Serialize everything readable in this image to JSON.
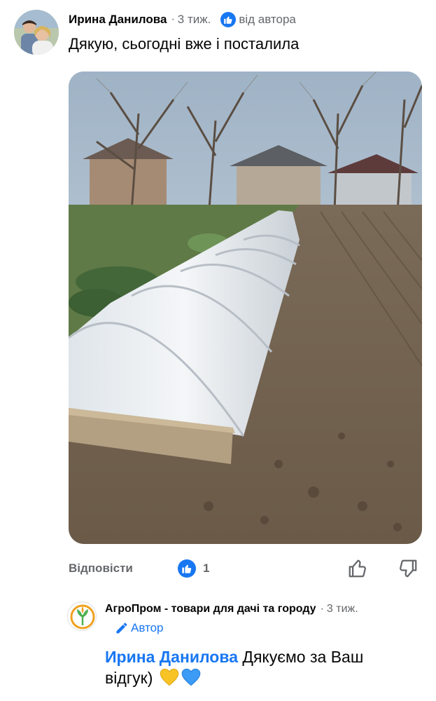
{
  "comment": {
    "author": "Ирина Данилова",
    "time": "3 тиж.",
    "from_author_label": "від автора",
    "text": "Дякую, сьогодні вже і посталила",
    "reply_label": "Відповісти",
    "reaction_count": "1"
  },
  "reply": {
    "author": "АгроПром - товари для дачі та городу",
    "time": "3 тиж.",
    "badge": "Автор",
    "mention": "Ирина Данилова",
    "text": " Дякуємо за Ваш відгук)"
  },
  "colors": {
    "accent": "#1877f2",
    "muted_text": "#65676b",
    "heart_yellow": "#f7c325",
    "heart_blue": "#3b9bf5"
  },
  "icons": [
    "like-icon",
    "thumbs-up-icon",
    "thumbs-down-icon",
    "pencil-icon",
    "yellow-heart-icon",
    "blue-heart-icon"
  ]
}
